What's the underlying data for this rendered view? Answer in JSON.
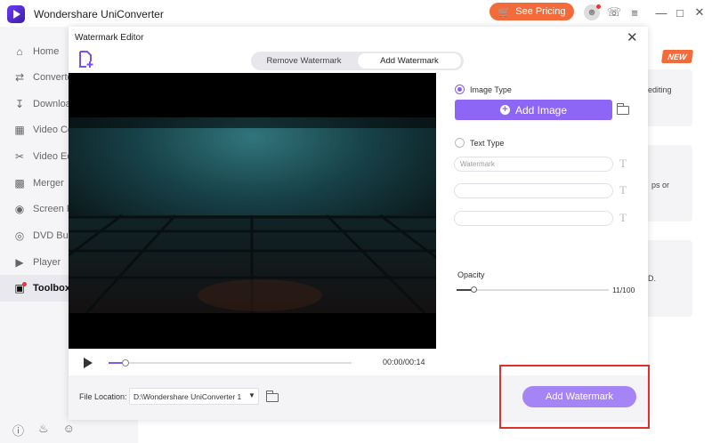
{
  "app": {
    "title": "Wondershare UniConverter",
    "pricing_label": "See Pricing",
    "accent": "#8e66f5",
    "pricing_color": "#f36b3a"
  },
  "sidebar": {
    "items": [
      {
        "label": "Home",
        "icon": "home-icon"
      },
      {
        "label": "Converter",
        "icon": "converter-icon"
      },
      {
        "label": "Downloader",
        "icon": "download-icon"
      },
      {
        "label": "Video Compressor",
        "icon": "video-compress-icon"
      },
      {
        "label": "Video Editor",
        "icon": "scissors-icon"
      },
      {
        "label": "Merger",
        "icon": "merger-icon"
      },
      {
        "label": "Screen Recorder",
        "icon": "screen-record-icon"
      },
      {
        "label": "DVD Burner",
        "icon": "dvd-icon"
      },
      {
        "label": "Player",
        "icon": "player-icon"
      },
      {
        "label": "Toolbox",
        "icon": "toolbox-icon",
        "active": true
      }
    ]
  },
  "background": {
    "new_badge": "NEW",
    "snippets": [
      "editing",
      "ps or",
      "D."
    ]
  },
  "dialog": {
    "title": "Watermark Editor",
    "tabs": [
      {
        "label": "Remove Watermark",
        "active": false
      },
      {
        "label": "Add Watermark",
        "active": true
      }
    ],
    "player": {
      "time": "00:00/00:14",
      "progress": 0.07
    },
    "panel": {
      "image_type_label": "Image Type",
      "image_type_selected": true,
      "add_image_label": "Add Image",
      "text_type_label": "Text Type",
      "text_type_selected": false,
      "text_inputs": [
        {
          "placeholder": "Watermark"
        },
        {
          "placeholder": ""
        },
        {
          "placeholder": ""
        }
      ],
      "opacity_label": "Opacity",
      "opacity_value": "11/100",
      "opacity_fraction": 0.11
    },
    "footer": {
      "file_location_label": "File Location:",
      "file_location_value": "D:\\Wondershare UniConverter 1",
      "add_watermark_label": "Add Watermark"
    }
  }
}
